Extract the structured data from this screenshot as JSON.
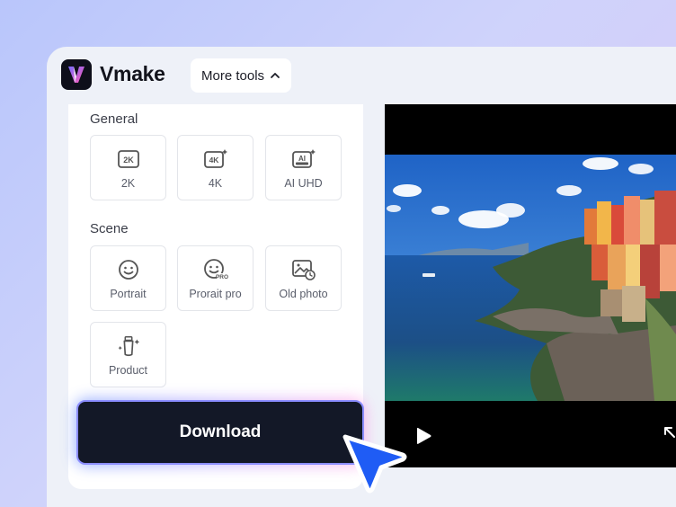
{
  "header": {
    "brand": "Vmake",
    "more_tools_label": "More tools"
  },
  "panel": {
    "general": {
      "title": "General",
      "items": [
        {
          "label": "2K",
          "icon": "2k-icon"
        },
        {
          "label": "4K",
          "icon": "4k-sparkle-icon"
        },
        {
          "label": "AI UHD",
          "icon": "ai-ultra-icon"
        }
      ]
    },
    "scene": {
      "title": "Scene",
      "items": [
        {
          "label": "Portrait",
          "icon": "smiley-icon"
        },
        {
          "label": "Prorait pro",
          "icon": "smiley-pro-icon"
        },
        {
          "label": "Old photo",
          "icon": "old-photo-icon"
        },
        {
          "label": "Product",
          "icon": "product-bottle-icon"
        }
      ]
    },
    "download_label": "Download"
  },
  "video": {
    "controls": [
      "play-icon",
      "expand-icon"
    ]
  },
  "colors": {
    "accent_cursor": "#1f5cf5",
    "button_bg": "#131827",
    "logo_gradient": [
      "#7b6cff",
      "#ff5ab4"
    ]
  }
}
